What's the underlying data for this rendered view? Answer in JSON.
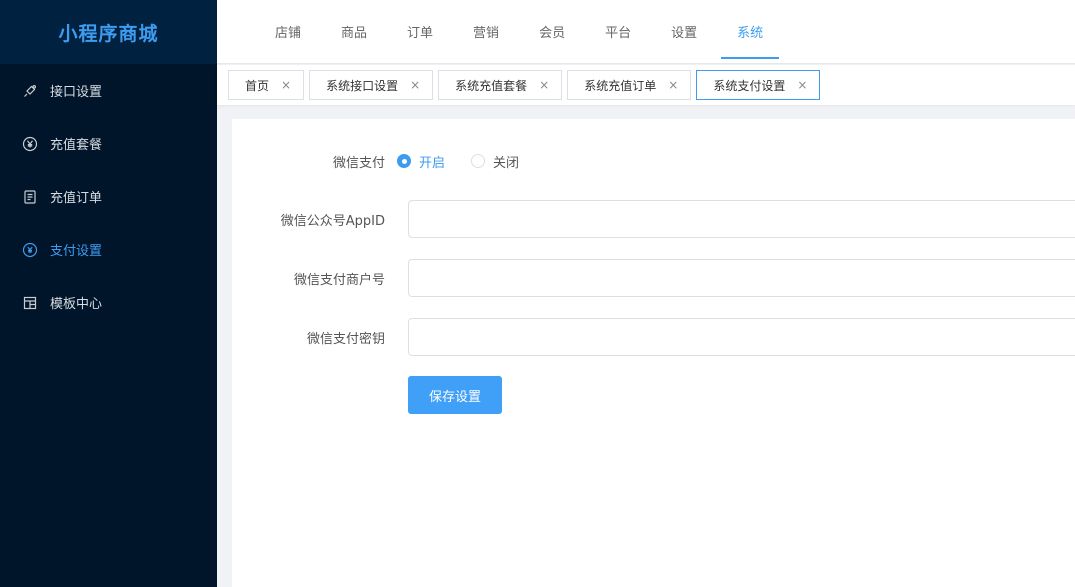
{
  "app": {
    "title": "小程序商城"
  },
  "sidebar": {
    "items": [
      {
        "label": "接口设置",
        "icon": "link-icon"
      },
      {
        "label": "充值套餐",
        "icon": "yuan-coin-icon"
      },
      {
        "label": "充值订单",
        "icon": "document-icon"
      },
      {
        "label": "支付设置",
        "icon": "payment-icon",
        "active": true
      },
      {
        "label": "模板中心",
        "icon": "template-icon"
      }
    ]
  },
  "topnav": {
    "items": [
      "店铺",
      "商品",
      "订单",
      "营销",
      "会员",
      "平台",
      "设置",
      "系统"
    ],
    "active_index": 7
  },
  "tabs": {
    "items": [
      {
        "label": "首页",
        "close": "×"
      },
      {
        "label": "系统接口设置",
        "close": "×"
      },
      {
        "label": "系统充值套餐",
        "close": "×"
      },
      {
        "label": "系统充值订单",
        "close": "×"
      },
      {
        "label": "系统支付设置",
        "close": "×",
        "active": true
      }
    ]
  },
  "form": {
    "wechat_pay": {
      "label": "微信支付",
      "options": [
        "开启",
        "关闭"
      ],
      "selected": "开启"
    },
    "appid": {
      "label": "微信公众号AppID",
      "value": ""
    },
    "merchant_id": {
      "label": "微信支付商户号",
      "value": ""
    },
    "secret_key": {
      "label": "微信支付密钥",
      "value": ""
    },
    "save_label": "保存设置"
  },
  "colors": {
    "accent": "#3d9cf0",
    "sidebar_bg": "#001529",
    "logo_bg": "#002140",
    "button_bg": "#40a0f7"
  }
}
